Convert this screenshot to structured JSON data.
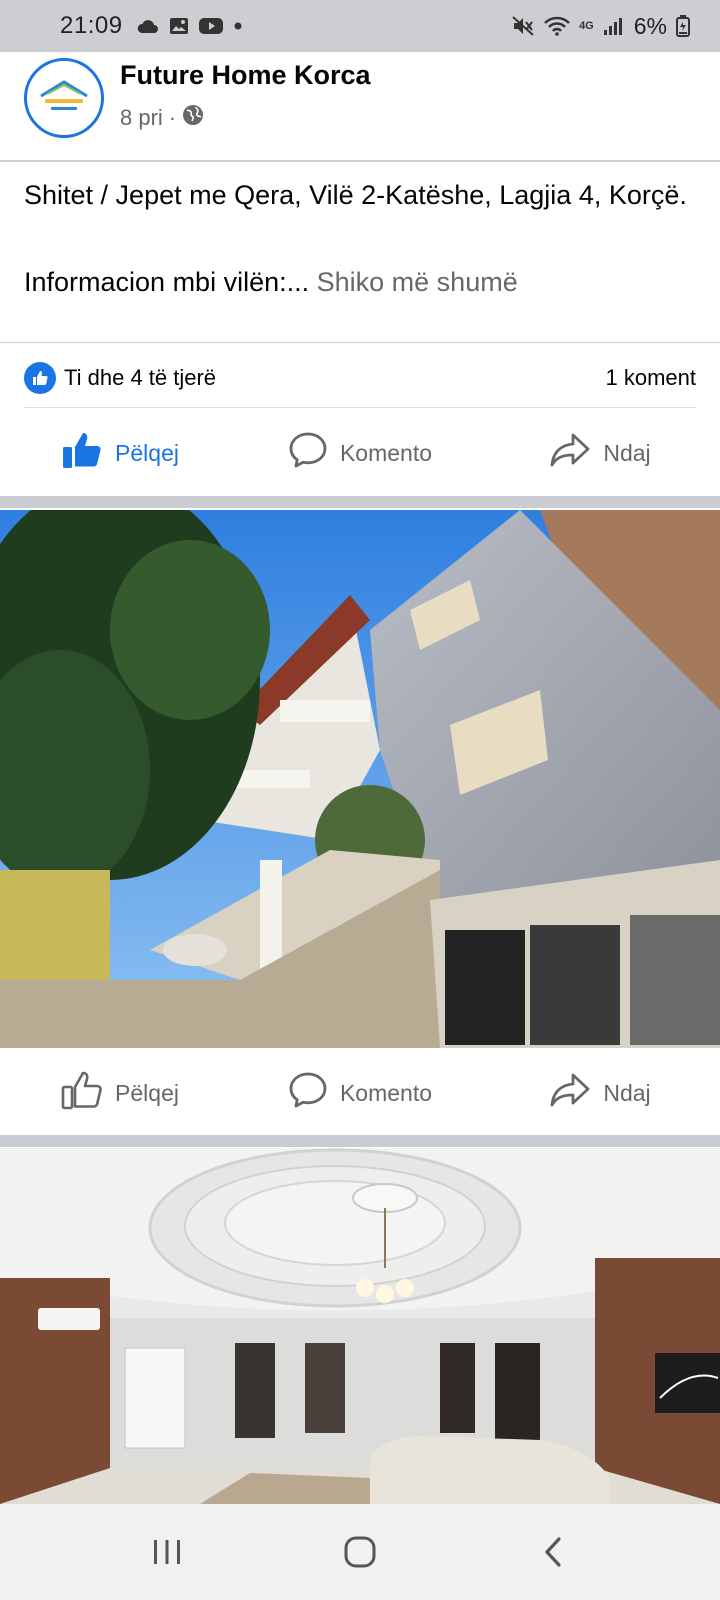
{
  "status_bar": {
    "time": "21:09",
    "battery": "6%",
    "network": "4G",
    "left_icons": [
      "cloud-icon",
      "gallery-icon",
      "youtube-icon",
      "dot-icon"
    ],
    "right_icons": [
      "mute-icon",
      "wifi-icon",
      "network-4g-icon",
      "signal-icon",
      "battery-icon"
    ]
  },
  "post": {
    "page_name": "Future Home Korca",
    "time": "8 pri",
    "separator": "·",
    "audience_icon": "globe-icon",
    "text_line1": "Shitet / Jepet me Qera, Vilë 2-Katëshe, Lagjia 4, Korçë.",
    "text_line2": "Informacion mbi vilën:...",
    "see_more": "Shiko më shumë",
    "reactions_text": "Ti dhe 4 të tjerë",
    "comments_count": "1 koment"
  },
  "actions_top": {
    "like": "Pëlqej",
    "comment": "Komento",
    "share": "Ndaj"
  },
  "actions_bottom": {
    "like": "Pëlqej",
    "comment": "Komento",
    "share": "Ndaj"
  },
  "colors": {
    "accent": "#1b74e4",
    "muted": "#65676b",
    "divider": "#ccd0d5",
    "status_bar_bg": "#ccced2"
  },
  "navigation": {
    "items": [
      "recent-apps-icon",
      "home-icon",
      "back-icon"
    ]
  }
}
